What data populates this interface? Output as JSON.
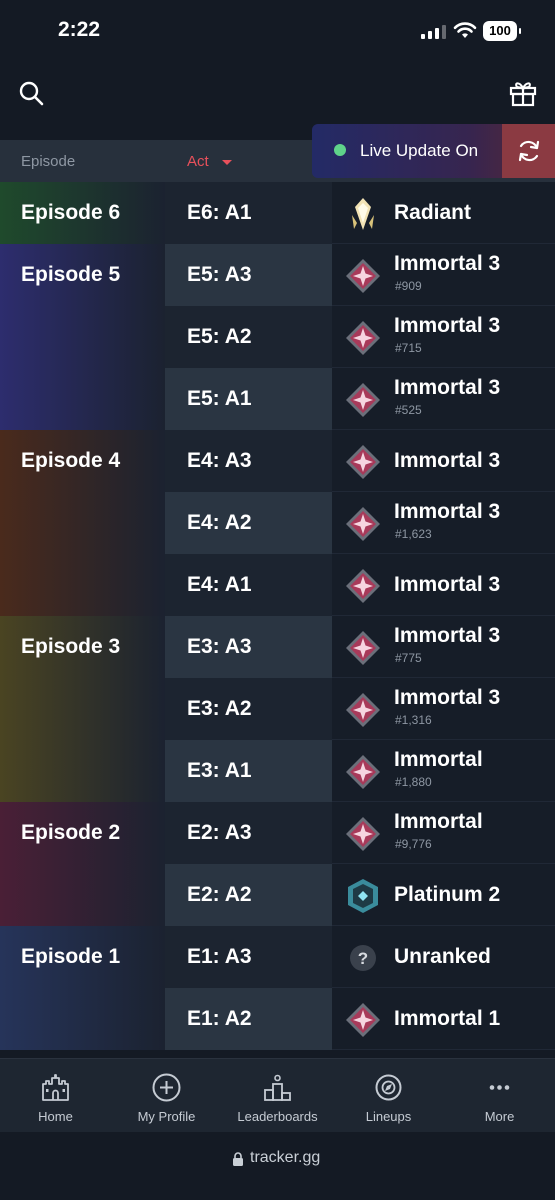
{
  "status_bar": {
    "time": "2:22",
    "battery": "100"
  },
  "header": {
    "columns": {
      "episode": "Episode",
      "act": "Act"
    },
    "live_update": {
      "label": "Live Update On",
      "dot_color": "#5fd38a"
    }
  },
  "rows": [
    {
      "episode": "Episode 6",
      "act": "E6: A1",
      "rank": "Radiant",
      "position": "",
      "icon": "radiant-icon",
      "ep_color": "#1f4a2c"
    },
    {
      "episode": "Episode 5",
      "act": "E5: A3",
      "rank": "Immortal 3",
      "position": "#909",
      "icon": "immortal-icon",
      "ep_color": "#2d2d6e"
    },
    {
      "episode": "",
      "act": "E5: A2",
      "rank": "Immortal 3",
      "position": "#715",
      "icon": "immortal-icon",
      "ep_color": "#2d2d6e"
    },
    {
      "episode": "",
      "act": "E5: A1",
      "rank": "Immortal 3",
      "position": "#525",
      "icon": "immortal-icon",
      "ep_color": "#2d2d6e"
    },
    {
      "episode": "Episode 4",
      "act": "E4: A3",
      "rank": "Immortal 3",
      "position": "",
      "icon": "immortal-icon",
      "ep_color": "#4a2a1c"
    },
    {
      "episode": "",
      "act": "E4: A2",
      "rank": "Immortal 3",
      "position": "#1,623",
      "icon": "immortal-icon",
      "ep_color": "#4a2a1c"
    },
    {
      "episode": "",
      "act": "E4: A1",
      "rank": "Immortal 3",
      "position": "",
      "icon": "immortal-icon",
      "ep_color": "#4a2a1c"
    },
    {
      "episode": "Episode 3",
      "act": "E3: A3",
      "rank": "Immortal 3",
      "position": "#775",
      "icon": "immortal-icon",
      "ep_color": "#4a4422"
    },
    {
      "episode": "",
      "act": "E3: A2",
      "rank": "Immortal 3",
      "position": "#1,316",
      "icon": "immortal-icon",
      "ep_color": "#4a4422"
    },
    {
      "episode": "",
      "act": "E3: A1",
      "rank": "Immortal",
      "position": "#1,880",
      "icon": "immortal-icon",
      "ep_color": "#4a4422"
    },
    {
      "episode": "Episode 2",
      "act": "E2: A3",
      "rank": "Immortal",
      "position": "#9,776",
      "icon": "immortal-icon",
      "ep_color": "#4a1f36"
    },
    {
      "episode": "",
      "act": "E2: A2",
      "rank": "Platinum 2",
      "position": "",
      "icon": "platinum-icon",
      "ep_color": "#4a1f36"
    },
    {
      "episode": "Episode 1",
      "act": "E1: A3",
      "rank": "Unranked",
      "position": "",
      "icon": "unranked-icon",
      "ep_color": "#26345a"
    },
    {
      "episode": "",
      "act": "E1: A2",
      "rank": "Immortal 1",
      "position": "",
      "icon": "immortal-icon",
      "ep_color": "#26345a"
    }
  ],
  "nav": [
    {
      "label": "Home",
      "icon": "castle-icon"
    },
    {
      "label": "My Profile",
      "icon": "plus-circle-icon"
    },
    {
      "label": "Leaderboards",
      "icon": "podium-icon"
    },
    {
      "label": "Lineups",
      "icon": "compass-icon"
    },
    {
      "label": "More",
      "icon": "more-dots-icon"
    }
  ],
  "url": "tracker.gg"
}
